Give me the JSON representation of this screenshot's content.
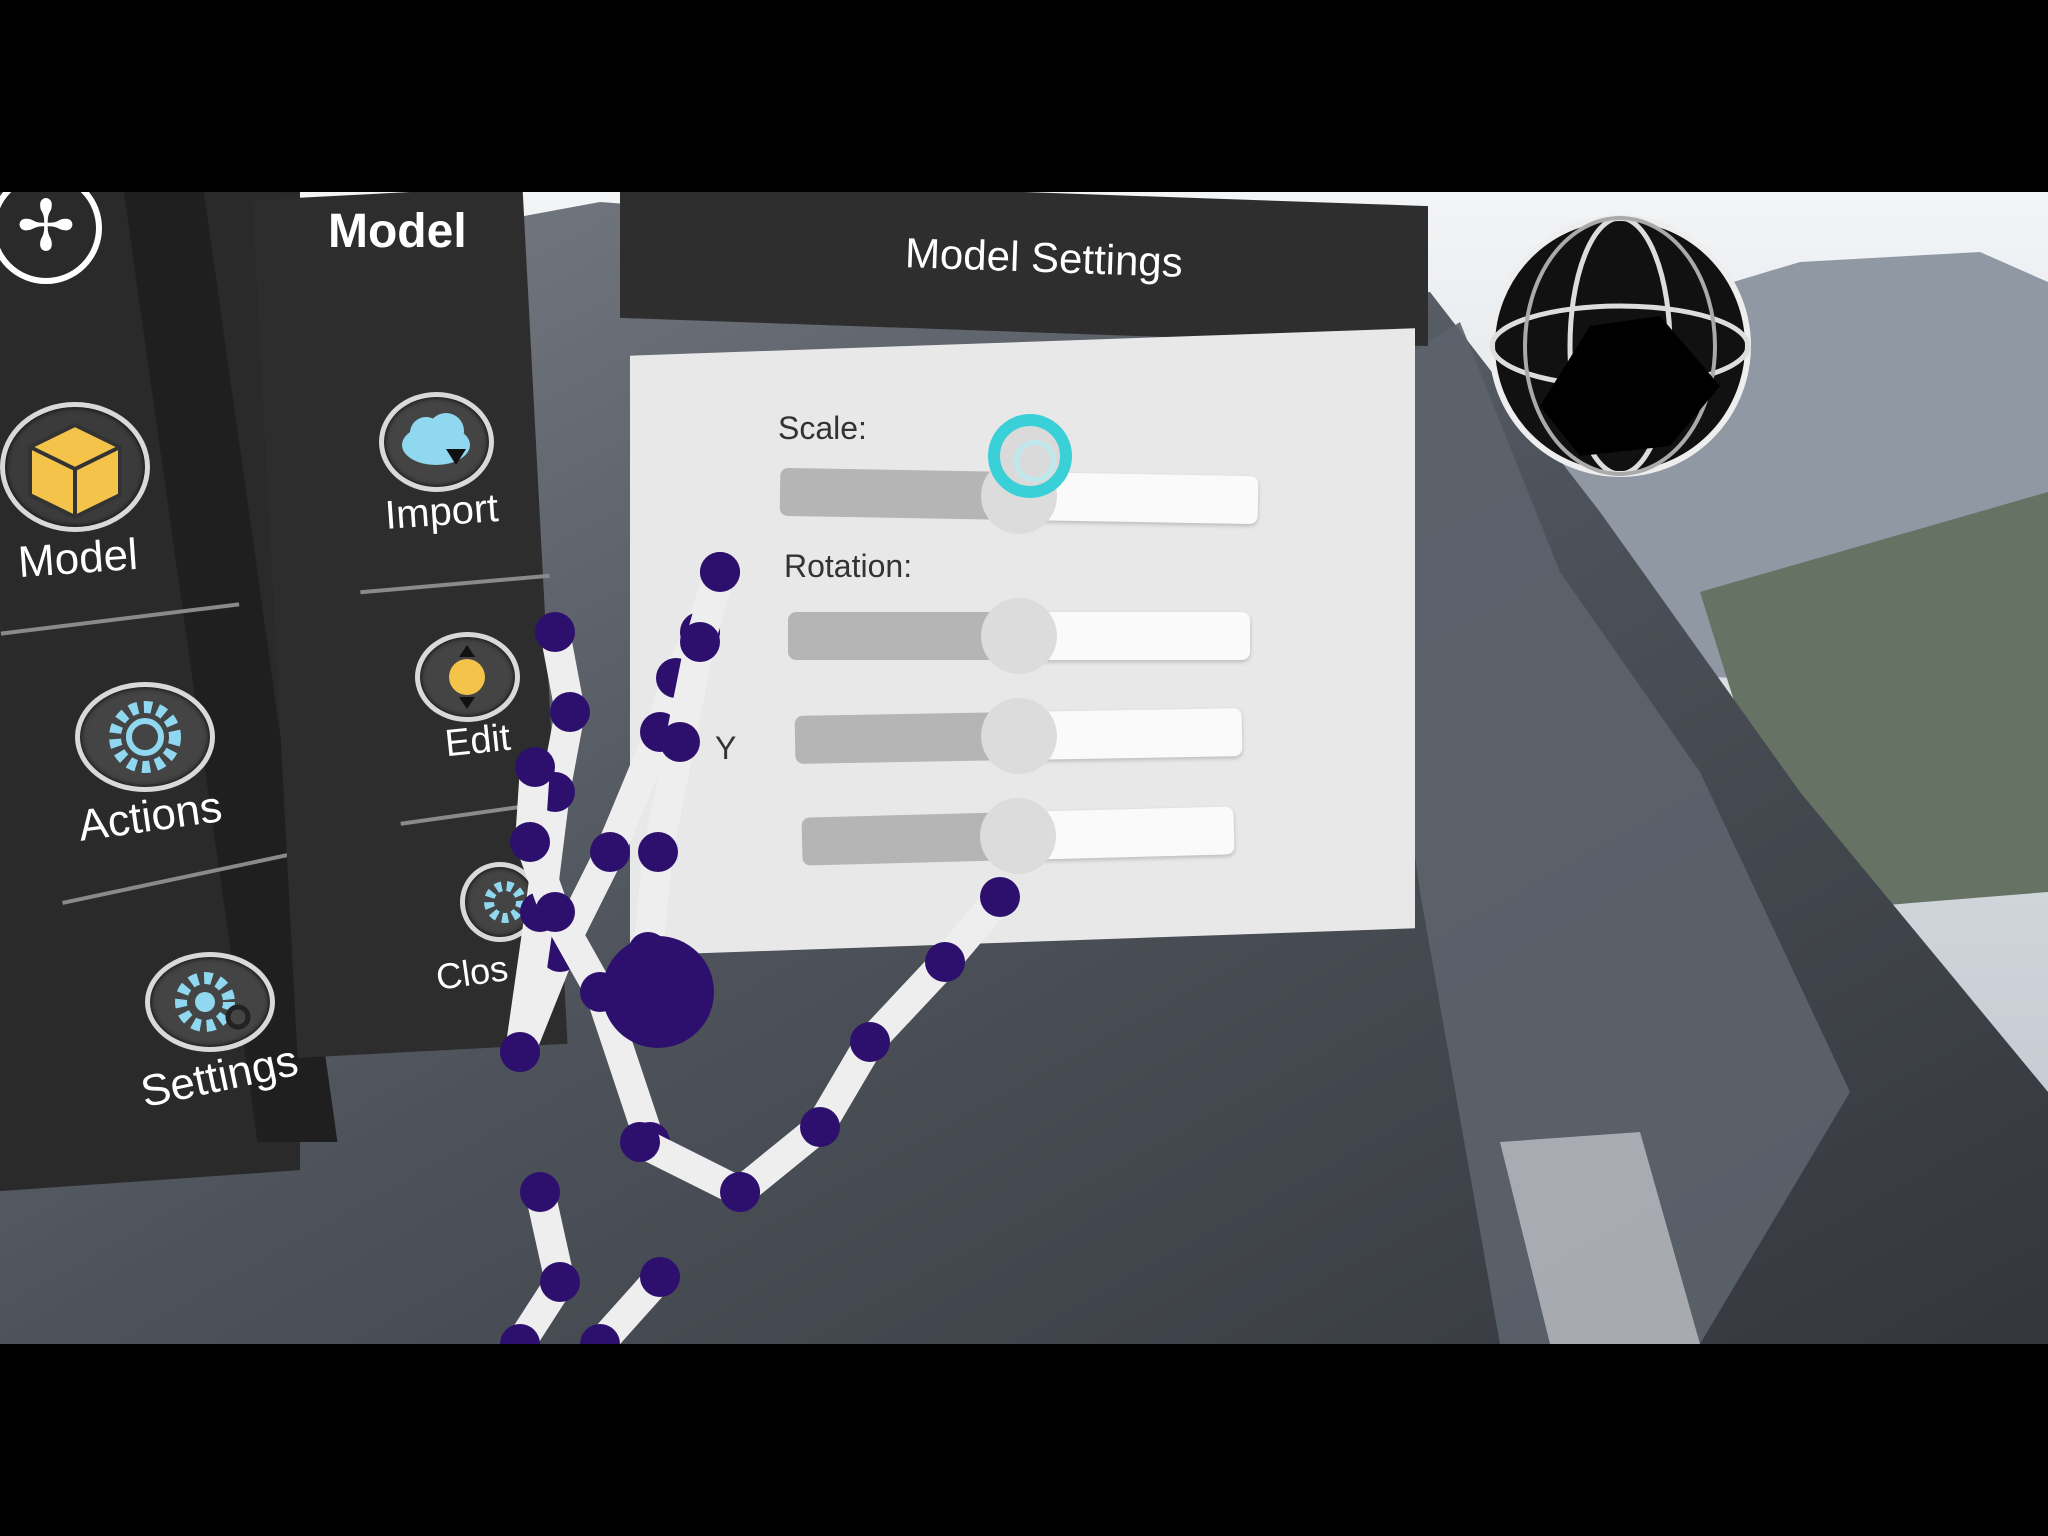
{
  "left_menu": {
    "items": [
      {
        "label": "Model",
        "icon": "cube-icon"
      },
      {
        "label": "Actions",
        "icon": "gear-icon"
      },
      {
        "label": "Settings",
        "icon": "settings-gear-icon"
      }
    ]
  },
  "sub_menu": {
    "title": "Model",
    "items": [
      {
        "label": "Import",
        "icon": "cloud-download-icon"
      },
      {
        "label": "Edit",
        "icon": "edit-arrows-icon"
      },
      {
        "label": "Clos",
        "icon": "gear-icon"
      }
    ]
  },
  "model_settings": {
    "title": "Model Settings",
    "scale_label": "Scale:",
    "rotation_label": "Rotation:",
    "axis_label": "Y",
    "sliders": [
      {
        "name": "scale",
        "value": 0.5
      },
      {
        "name": "rotation-x",
        "value": 0.5
      },
      {
        "name": "rotation-y",
        "value": 0.5
      },
      {
        "name": "rotation-z",
        "value": 0.5
      }
    ]
  },
  "colors": {
    "hand_joint": "#2d0f6e",
    "hand_bone": "#eeeeee",
    "cursor_ring": "#3ad0d8",
    "panel_dark": "#2c2c2c",
    "accent_yellow": "#f3c34a",
    "accent_cyan": "#8fd8ef"
  }
}
